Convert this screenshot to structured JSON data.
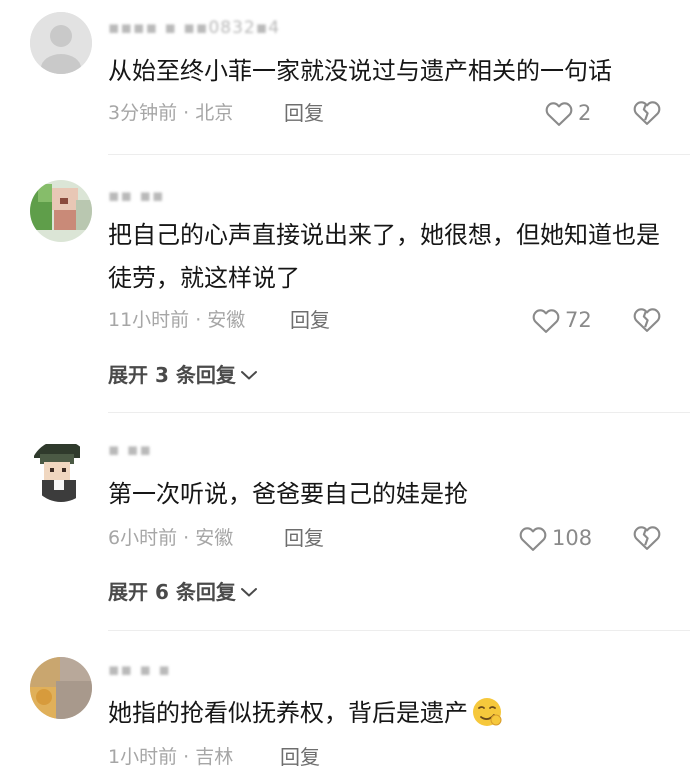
{
  "comments": [
    {
      "username": "▪▪▪▪ ▪ ▪▪0832▪4",
      "text": "从始至终小菲一家就没说过与遗产相关的一句话",
      "meta": "3分钟前 · 北京",
      "reply_label": "回复",
      "likes": "2",
      "avatar_icon": "avatar-placeholder-icon"
    },
    {
      "username": "▪▪ ▪▪",
      "text": "把自己的心声直接说出来了，她很想，但她知道也是徒劳，就这样说了",
      "meta": "11小时前 · 安徽",
      "reply_label": "回复",
      "likes": "72",
      "expand_label": "展开 3 条回复"
    },
    {
      "username": "▪ ▪▪",
      "text": "第一次听说，爸爸要自己的娃是抢",
      "meta": "6小时前 · 安徽",
      "reply_label": "回复",
      "likes": "108",
      "expand_label": "展开 6 条回复"
    },
    {
      "username": "▪▪ ▪ ▪",
      "text": "她指的抢看似抚养权，背后是遗产",
      "meta": "1小时前 · 吉林",
      "reply_label": "回复",
      "emoji_icon": "smirk-emoji-icon"
    }
  ],
  "colors": {
    "text": "#161616",
    "meta": "#a6a6a6",
    "icon": "#8a8a8a"
  }
}
